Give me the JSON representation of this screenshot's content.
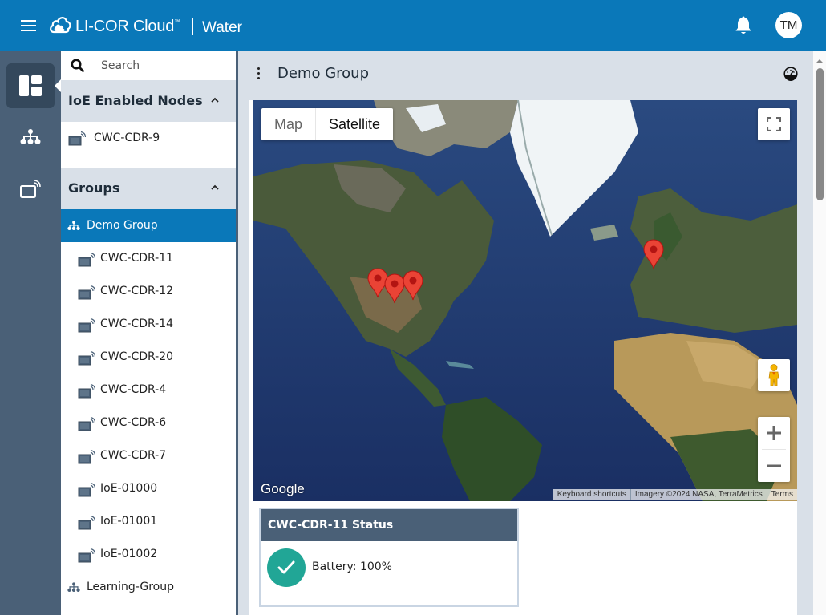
{
  "header": {
    "brand": "LI-COR Cloud",
    "trademark": "™",
    "product": "Water",
    "avatar_initials": "TM",
    "color": "#0a78b9"
  },
  "rail": {
    "items": [
      {
        "name": "dashboard",
        "active": true
      },
      {
        "name": "groups",
        "active": false
      },
      {
        "name": "devices",
        "active": false
      }
    ]
  },
  "tree": {
    "search_placeholder": "Search",
    "sections": [
      {
        "title": "IoE Enabled Nodes",
        "nodes": [
          "CWC-CDR-9"
        ]
      },
      {
        "title": "Groups",
        "groups": [
          {
            "label": "Demo Group",
            "selected": true,
            "nodes": [
              "CWC-CDR-11",
              "CWC-CDR-12",
              "CWC-CDR-14",
              "CWC-CDR-20",
              "CWC-CDR-4",
              "CWC-CDR-6",
              "CWC-CDR-7",
              "IoE-01000",
              "IoE-01001",
              "IoE-01002"
            ]
          },
          {
            "label": "Learning-Group",
            "selected": false,
            "nodes": []
          }
        ]
      }
    ]
  },
  "main": {
    "title": "Demo Group",
    "map": {
      "type_options": [
        "Map",
        "Satellite"
      ],
      "selected_type": "Satellite",
      "logo": "Google",
      "attribution": [
        "Keyboard shortcuts",
        "Imagery ©2024 NASA, TerraMetrics",
        "Terms"
      ],
      "zoom_in": "+",
      "zoom_out": "−",
      "markers": 4
    },
    "status_card": {
      "title": "CWC-CDR-11 Status",
      "battery_label": "Battery: 100%",
      "status_color": "#21a696"
    }
  }
}
